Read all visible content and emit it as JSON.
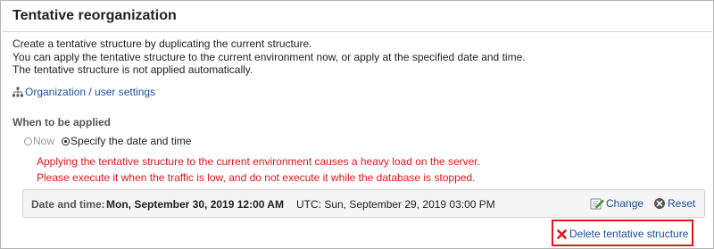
{
  "header": {
    "title": "Tentative reorganization"
  },
  "description": [
    "Create a tentative structure by duplicating the current structure.",
    "You can apply the tentative structure to the current environment now, or apply at the specified date and time.",
    "The tentative structure is not applied automatically."
  ],
  "org_link": {
    "label": "Organization / user settings",
    "icon": "org-chart-icon"
  },
  "apply": {
    "label": "When to be applied",
    "options": [
      {
        "label": "Now",
        "selected": false,
        "disabled": true
      },
      {
        "label": "Specify the date and time",
        "selected": true,
        "disabled": false
      }
    ]
  },
  "warning": [
    "Applying the tentative structure to the current environment causes a heavy load on the server.",
    "Please execute it when the traffic is low, and do not execute it while the database is stopped."
  ],
  "schedule": {
    "label": "Date and time:",
    "value": "Mon, September 30, 2019 12:00 AM",
    "utc": "UTC: Sun, September 29, 2019 03:00 PM",
    "change_label": "Change",
    "reset_label": "Reset"
  },
  "delete": {
    "label": "Delete tentative structure"
  },
  "colors": {
    "link": "#1a4e99",
    "warning": "#e0161b",
    "highlight_border": "#e0161b"
  }
}
